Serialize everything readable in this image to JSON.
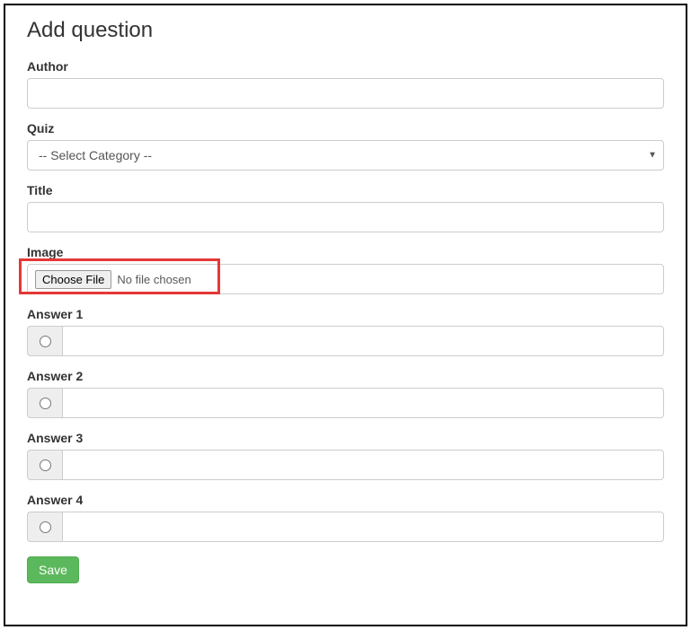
{
  "page_title": "Add question",
  "fields": {
    "author": {
      "label": "Author",
      "value": ""
    },
    "quiz": {
      "label": "Quiz",
      "selected": "-- Select Category --"
    },
    "title": {
      "label": "Title",
      "value": ""
    },
    "image": {
      "label": "Image",
      "button": "Choose File",
      "status": "No file chosen"
    }
  },
  "answers": [
    {
      "label": "Answer 1",
      "value": "",
      "checked": false
    },
    {
      "label": "Answer 2",
      "value": "",
      "checked": false
    },
    {
      "label": "Answer 3",
      "value": "",
      "checked": false
    },
    {
      "label": "Answer 4",
      "value": "",
      "checked": false
    }
  ],
  "actions": {
    "save": "Save"
  }
}
